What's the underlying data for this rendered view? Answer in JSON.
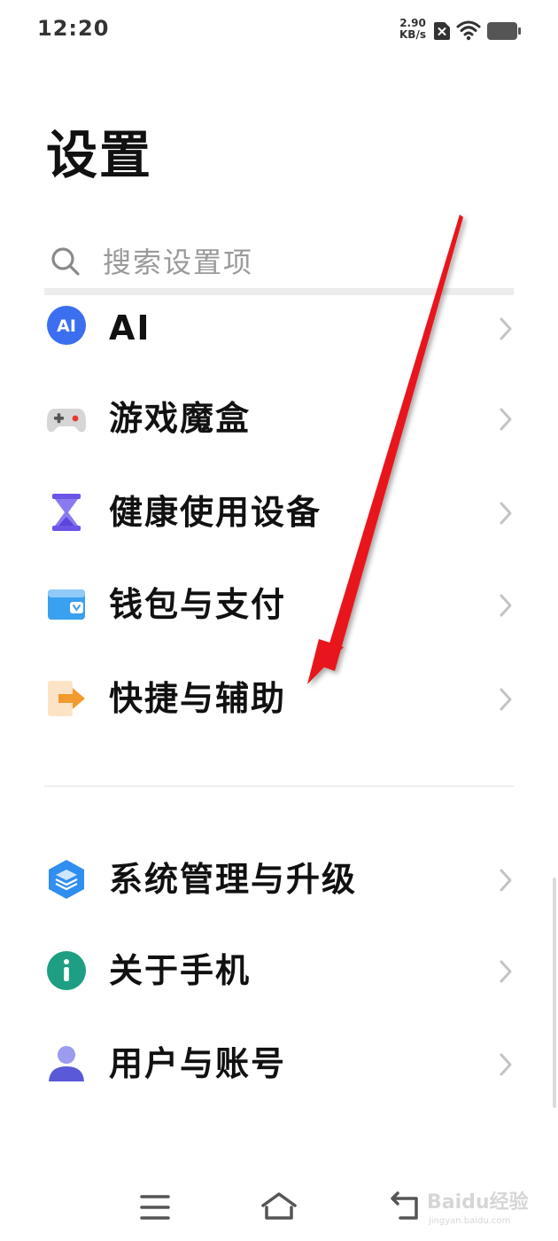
{
  "status_bar": {
    "time": "12:20",
    "net_speed_value": "2.90",
    "net_speed_unit": "KB/s"
  },
  "page": {
    "title": "设置"
  },
  "search": {
    "placeholder": "搜索设置项"
  },
  "items": [
    {
      "label": "AI",
      "icon": "ai-icon",
      "icon_text": "AI",
      "color": "#3b6ff0"
    },
    {
      "label": "游戏魔盒",
      "icon": "gamepad-icon",
      "color": "#9e9e9e"
    },
    {
      "label": "健康使用设备",
      "icon": "hourglass-icon",
      "color": "#6a55e6"
    },
    {
      "label": "钱包与支付",
      "icon": "wallet-icon",
      "color": "#3aa0f0"
    },
    {
      "label": "快捷与辅助",
      "icon": "shortcut-icon",
      "color": "#f39a2e"
    },
    {
      "label": "系统管理与升级",
      "icon": "layers-icon",
      "color": "#2f8ef0"
    },
    {
      "label": "关于手机",
      "icon": "info-icon",
      "color": "#1e9e82"
    },
    {
      "label": "用户与账号",
      "icon": "user-icon",
      "color": "#6b6be0"
    }
  ],
  "nav": {
    "menu": "menu-icon",
    "home": "home-icon",
    "back": "back-icon"
  },
  "watermark": {
    "text": "Baidu经验",
    "sub": "jingyan.baidu.com"
  },
  "colors": {
    "annotation_arrow": "#e8141a",
    "chevron": "#c4c4c4"
  }
}
